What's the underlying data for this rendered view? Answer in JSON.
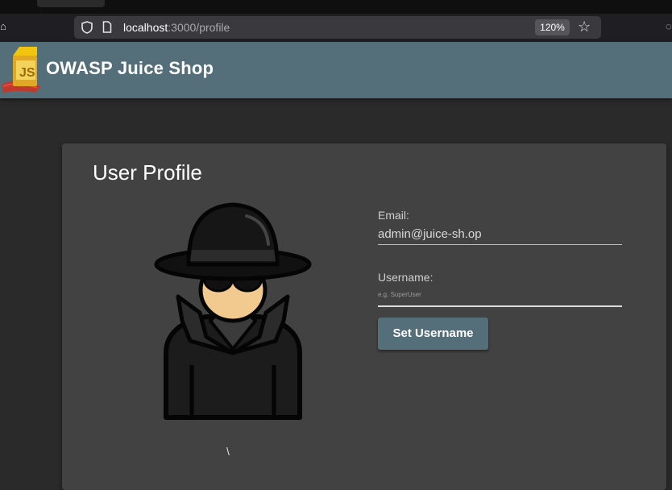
{
  "browser": {
    "tab_strip_text": "(",
    "url_host": "localhost",
    "url_path": ":3000/profile",
    "zoom": "120%"
  },
  "app": {
    "title": "OWASP Juice Shop",
    "accent": "#546e7a"
  },
  "profile": {
    "title": "User Profile",
    "avatar_caption": "\\",
    "email_label": "Email:",
    "email_value": "admin@juice-sh.op",
    "username_label": "Username:",
    "username_placeholder": "e.g. SuperUser",
    "submit_label": "Set Username"
  },
  "icons": {
    "home": "home-icon",
    "shield": "shield-icon",
    "page": "page-icon",
    "star": "star-icon",
    "pocket": "pocket-icon",
    "logo": "juice-shop-logo"
  }
}
